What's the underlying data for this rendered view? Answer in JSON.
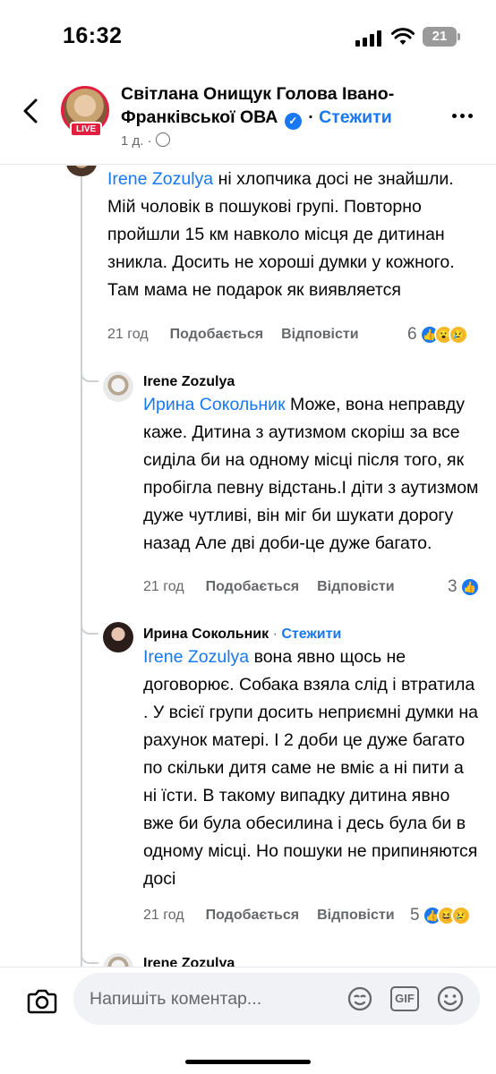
{
  "status_bar": {
    "time": "16:32",
    "battery": "21"
  },
  "header": {
    "name_line1": "Світлана Онищук Голова Івано-",
    "name_line2": "Франківської ОВА",
    "dot": "·",
    "follow": "Стежити",
    "time": "1 д.",
    "meta_dot": "·",
    "live": "LIVE"
  },
  "comments": [
    {
      "mention": "Irene Zozulya",
      "text": " ні хлопчика досі не знайшли.  Мій чоловік в пошукові  групі.  Повторно  пройшли  15 км навколо місця  де дитинан зникла.  Досить  не хороші  думки  у кожного.  Там мама  не подарок  як виявляется",
      "time": "21 год",
      "like": "Подобається",
      "reply": "Відповісти",
      "reaction_count": "6"
    },
    {
      "author": "Irene Zozulya",
      "mention": "Ирина Сокольник",
      "text": " Може, вона неправду каже. Дитина з аутизмом скоріш за все сиділа би на одному місці після того, як пробігла певну відстань.І діти з аутизмом дуже чутливі, він міг би шукати дорогу назад  Але дві доби-це дуже багато.",
      "time": "21 год",
      "like": "Подобається",
      "reply": "Відповісти",
      "reaction_count": "3"
    },
    {
      "author": "Ирина Сокольник",
      "author_dot": "·",
      "author_follow": "Стежити",
      "mention": "Irene Zozulya",
      "text": " вона явно щось  не договорює.  Собака взяла слід  і втратила   . У всієї групи досить неприємні думки на рахунок матері. І 2 доби це дуже багато  по скільки дитя  саме не вміє а ні пити а ні їсти. В такому  випадку  дитина явно вже би була обесилина  і десь  була би в одному місці.  Но пошуки  не припиняются  досі",
      "time": "21 год",
      "like": "Подобається",
      "reply": "Відповісти",
      "reaction_count": "5"
    },
    {
      "author": "Irene Zozulya"
    }
  ],
  "composer": {
    "placeholder": "Напишіть коментар...",
    "gif_label": "GIF"
  },
  "colors": {
    "accent": "#1877f2",
    "live": "#e41e3f",
    "muted": "#65676b"
  }
}
